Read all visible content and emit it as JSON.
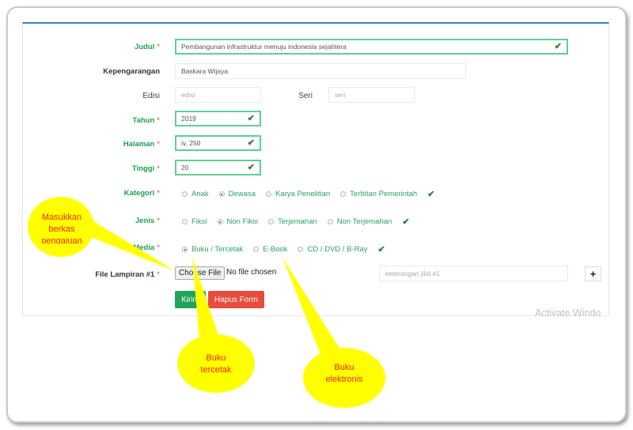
{
  "form": {
    "judul": {
      "label": "Judul",
      "value": "Pembangunan infrastruktur menuju indonesia sejahtera"
    },
    "kepengarangan": {
      "label": "Kepengarangan",
      "value": "Baskara Wijaya"
    },
    "edisi": {
      "label": "Edisi",
      "placeholder": "edisi"
    },
    "seri": {
      "label": "Seri",
      "placeholder": "seri"
    },
    "tahun": {
      "label": "Tahun",
      "value": "2019"
    },
    "halaman": {
      "label": "Halaman",
      "value": "iv, 250"
    },
    "tinggi": {
      "label": "Tinggi",
      "value": "20"
    },
    "kategori": {
      "label": "Kategori",
      "options": [
        "Anak",
        "Dewasa",
        "Karya Penelitian",
        "Terbitan Pemerintah"
      ],
      "selected": "Dewasa"
    },
    "jenis": {
      "label": "Jenis",
      "options": [
        "Fiksi",
        "Non Fiksi",
        "Terjemahan",
        "Non Terjemahan"
      ],
      "selected": "Non Fiksi"
    },
    "media": {
      "label": "Media",
      "options": [
        "Buku / Tercetak",
        "E-Book",
        "CD / DVD / B-Ray"
      ],
      "selected": "Buku / Tercetak"
    },
    "file": {
      "label": "File Lampiran #1",
      "button": "Choose File",
      "status": "No file chosen",
      "keterangan_placeholder": "keterangan jilid #1",
      "add": "+"
    },
    "required_mark": "*",
    "check": "✔",
    "submit": "Kirim",
    "reset": "Hapus Form"
  },
  "watermark": "Activate Windo",
  "callouts": {
    "c1": "Masukkan berkas pengajuan",
    "c2": "Buku tercetak",
    "c3": "Buku elektronis"
  },
  "colors": {
    "accent": "#1e9e50",
    "primary_line": "#3c7fc4",
    "submit": "#1fa45a",
    "reset": "#e74c3c",
    "callout": "#ffff00",
    "callout_text": "#ff2200"
  }
}
